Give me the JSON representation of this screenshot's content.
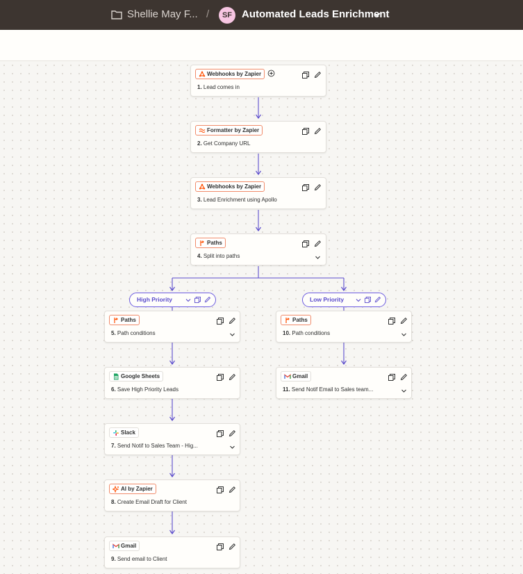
{
  "topbar": {
    "folder_name": "Shellie May F...",
    "separator": "/",
    "avatar_initials": "SF",
    "zap_title": "Automated Leads Enrichment"
  },
  "colors": {
    "topbar_bg": "#3d3530",
    "accent_orange": "#ff4f00",
    "path_purple": "#6d5ce0",
    "avatar_pink": "#f7c6e2"
  },
  "steps": [
    {
      "app": "Webhooks by Zapier",
      "number": "1.",
      "title": "Lead comes in",
      "icon": "webhook-icon"
    },
    {
      "app": "Formatter by Zapier",
      "number": "2.",
      "title": "Get Company URL",
      "icon": "formatter-icon"
    },
    {
      "app": "Webhooks by Zapier",
      "number": "3.",
      "title": "Lead Enrichment using Apollo",
      "icon": "webhook-icon"
    },
    {
      "app": "Paths",
      "number": "4.",
      "title": "Split into paths",
      "icon": "paths-icon"
    },
    {
      "app": "Paths",
      "number": "5.",
      "title": "Path conditions",
      "icon": "paths-icon"
    },
    {
      "app": "Google Sheets",
      "number": "6.",
      "title": "Save High Priority Leads",
      "icon": "google-sheets-icon"
    },
    {
      "app": "Slack",
      "number": "7.",
      "title": "Send Notif to Sales Team - Hig...",
      "icon": "slack-icon"
    },
    {
      "app": "AI by Zapier",
      "number": "8.",
      "title": "Create Email Draft for Client",
      "icon": "ai-icon"
    },
    {
      "app": "Gmail",
      "number": "9.",
      "title": "Send email to Client",
      "icon": "gmail-icon"
    },
    {
      "app": "Paths",
      "number": "10.",
      "title": "Path conditions",
      "icon": "paths-icon"
    },
    {
      "app": "Gmail",
      "number": "11.",
      "title": "Send Notif Email to Sales team...",
      "icon": "gmail-icon"
    }
  ],
  "paths": [
    {
      "label": "High Priority"
    },
    {
      "label": "Low Priority"
    }
  ]
}
